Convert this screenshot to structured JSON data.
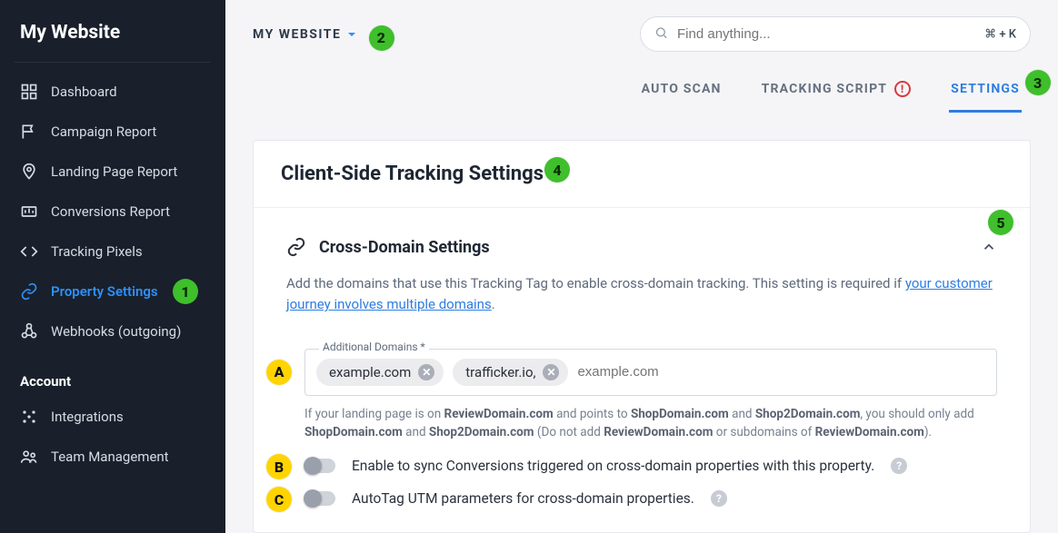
{
  "brand": "My Website",
  "sidebar": {
    "items": [
      {
        "label": "Dashboard",
        "icon": "dashboard"
      },
      {
        "label": "Campaign Report",
        "icon": "flag"
      },
      {
        "label": "Landing Page Report",
        "icon": "pin"
      },
      {
        "label": "Conversions Report",
        "icon": "bar"
      },
      {
        "label": "Tracking Pixels",
        "icon": "code"
      },
      {
        "label": "Property Settings",
        "icon": "link",
        "active": true
      },
      {
        "label": "Webhooks (outgoing)",
        "icon": "hooks"
      }
    ],
    "account_label": "Account",
    "account_items": [
      {
        "label": "Integrations",
        "icon": "dots"
      },
      {
        "label": "Team Management",
        "icon": "people"
      }
    ]
  },
  "header": {
    "site_switcher_label": "MY WEBSITE",
    "search_placeholder": "Find anything...",
    "kbd_hint": "⌘ + K",
    "tabs": [
      {
        "label": "AUTO SCAN"
      },
      {
        "label": "TRACKING SCRIPT",
        "warning": true
      },
      {
        "label": "SETTINGS",
        "active": true
      }
    ]
  },
  "panel": {
    "title": "Client-Side Tracking Settings",
    "cross_domain": {
      "title": "Cross-Domain Settings",
      "desc_prefix": "Add the domains that use this Tracking Tag to enable cross-domain tracking. This setting is required if ",
      "desc_link": "your customer journey involves multiple domains",
      "desc_suffix": ".",
      "field_label": "Additional Domains *",
      "chips": [
        "example.com",
        "trafficker.io,"
      ],
      "input_placeholder": "example.com",
      "helper_html": "If your landing page is on <b>ReviewDomain.com</b> and points to <b>ShopDomain.com</b> and <b>Shop2Domain.com</b>, you should only add <b>ShopDomain.com</b> and <b>Shop2Domain.com</b> (Do not add <b>ReviewDomain.com</b> or subdomains of <b>ReviewDomain.com</b>).",
      "toggle1": "Enable to sync Conversions triggered on cross-domain properties with this property.",
      "toggle2": "AutoTag UTM parameters for cross-domain properties."
    }
  },
  "annotations": {
    "n1": "1",
    "n2": "2",
    "n3": "3",
    "n4": "4",
    "n5": "5",
    "a": "A",
    "b": "B",
    "c": "C"
  }
}
